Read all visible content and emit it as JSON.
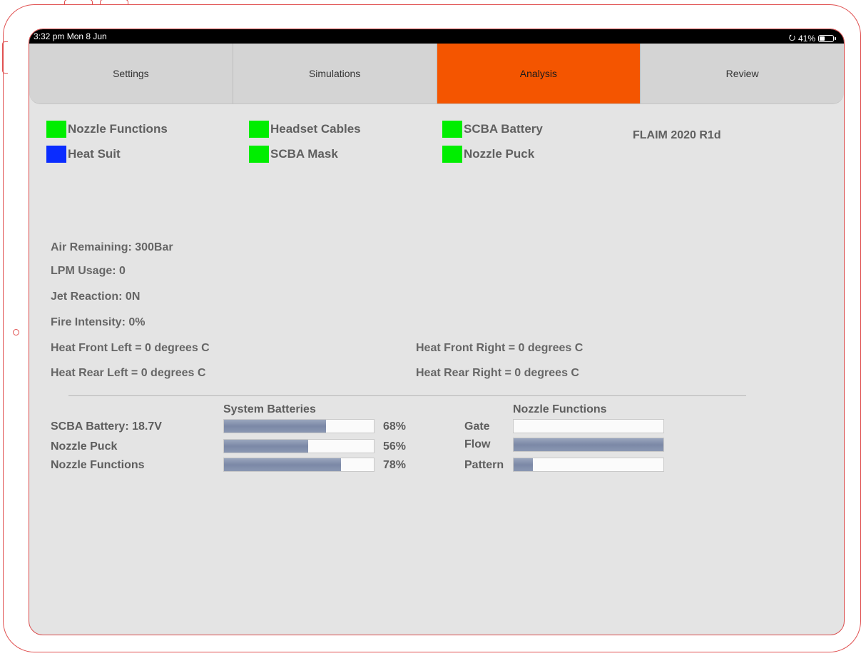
{
  "status_bar": {
    "time": "3:32 pm  Mon 8 Jun",
    "orientation_icon": "orientation-lock-icon",
    "battery_percent": "41%",
    "battery_level": 0.41
  },
  "tabs": [
    {
      "label": "Settings",
      "active": false
    },
    {
      "label": "Simulations",
      "active": false
    },
    {
      "label": "Analysis",
      "active": true
    },
    {
      "label": "Review",
      "active": false
    }
  ],
  "colors": {
    "active_tab": "#f45500",
    "status_ok": "#00ee00",
    "status_blue": "#0a2cff"
  },
  "indicators": [
    {
      "label": "Nozzle Functions",
      "color": "#00ee00"
    },
    {
      "label": "Heat Suit",
      "color": "#0a2cff"
    },
    {
      "label": "Headset Cables",
      "color": "#00ee00"
    },
    {
      "label": "SCBA Mask",
      "color": "#00ee00"
    },
    {
      "label": "SCBA Battery",
      "color": "#00ee00"
    },
    {
      "label": "Nozzle Puck",
      "color": "#00ee00"
    }
  ],
  "version": "FLAIM 2020 R1d",
  "readouts": {
    "air_remaining": "Air Remaining: 300Bar",
    "lpm_usage": "LPM Usage: 0",
    "jet_reaction": "Jet Reaction: 0N",
    "fire_intensity": "Fire Intensity: 0%",
    "heat_front_left": "Heat Front Left = 0 degrees C",
    "heat_front_right": "Heat Front Right = 0 degrees C",
    "heat_rear_left": "Heat Rear Left = 0 degrees C",
    "heat_rear_right": "Heat Rear Right = 0 degrees C"
  },
  "system_batteries": {
    "title": "System Batteries",
    "items": [
      {
        "label": "SCBA Battery: 18.7V",
        "level": 0.68,
        "percent": "68%"
      },
      {
        "label": "Nozzle Puck",
        "level": 0.56,
        "percent": "56%"
      },
      {
        "label": "Nozzle Functions",
        "level": 0.78,
        "percent": "78%"
      }
    ]
  },
  "nozzle_functions": {
    "title": "Nozzle Functions",
    "items": [
      {
        "label": "Gate",
        "level": 0.0
      },
      {
        "label": "Flow",
        "level": 1.0
      },
      {
        "label": "Pattern",
        "level": 0.13
      }
    ]
  }
}
